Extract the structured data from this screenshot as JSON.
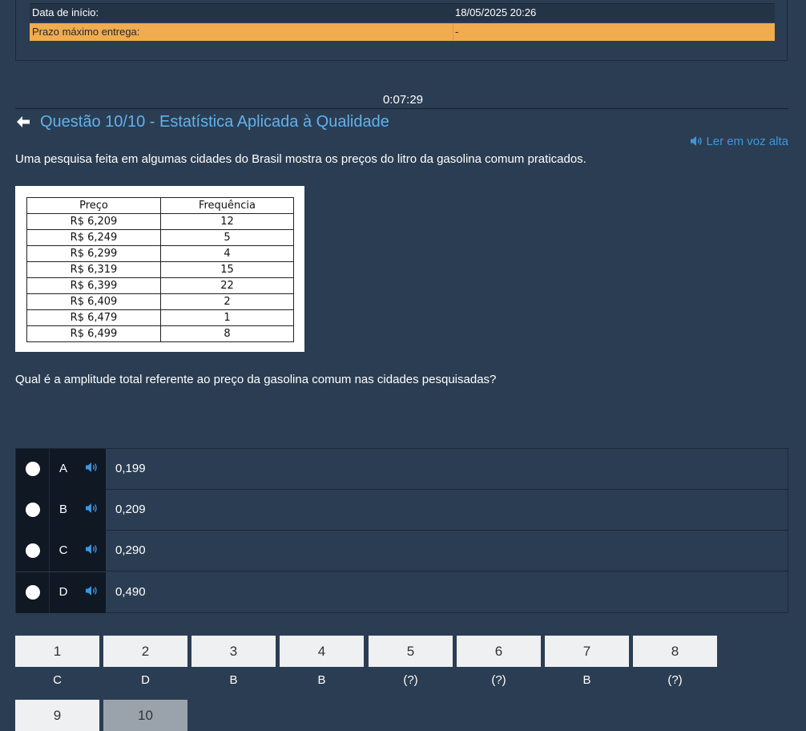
{
  "info": {
    "start_label": "Data de início:",
    "start_value": "18/05/2025 20:26",
    "deadline_label": "Prazo máximo entrega:",
    "deadline_value": "-"
  },
  "timer": "0:07:29",
  "question": {
    "title": "Questão 10/10 - Estatística Aplicada à Qualidade",
    "read_aloud_label": "Ler em voz alta",
    "statement": "Uma pesquisa feita em algumas cidades do Brasil mostra os preços do litro da gasolina comum praticados.",
    "prompt": "Qual é a amplitude total referente ao preço da gasolina comum nas cidades pesquisadas?"
  },
  "table": {
    "headers": [
      "Preço",
      "Frequência"
    ],
    "rows": [
      [
        "R$ 6,209",
        "12"
      ],
      [
        "R$ 6,249",
        "5"
      ],
      [
        "R$ 6,299",
        "4"
      ],
      [
        "R$ 6,319",
        "15"
      ],
      [
        "R$ 6,399",
        "22"
      ],
      [
        "R$ 6,409",
        "2"
      ],
      [
        "R$ 6,479",
        "1"
      ],
      [
        "R$ 6,499",
        "8"
      ]
    ]
  },
  "options": [
    {
      "letter": "A",
      "text": "0,199"
    },
    {
      "letter": "B",
      "text": "0,209"
    },
    {
      "letter": "C",
      "text": "0,290"
    },
    {
      "letter": "D",
      "text": "0,490"
    }
  ],
  "navigation": [
    {
      "number": "1",
      "answer": "C"
    },
    {
      "number": "2",
      "answer": "D"
    },
    {
      "number": "3",
      "answer": "B"
    },
    {
      "number": "4",
      "answer": "B"
    },
    {
      "number": "5",
      "answer": "(?)"
    },
    {
      "number": "6",
      "answer": "(?)"
    },
    {
      "number": "7",
      "answer": "B"
    },
    {
      "number": "8",
      "answer": "(?)"
    },
    {
      "number": "9",
      "answer": ""
    },
    {
      "number": "10",
      "answer": ""
    }
  ],
  "colors": {
    "background": "#2b3d52",
    "deadline_highlight": "#f0ac4e",
    "title_link": "#5fb2f0",
    "option_cell": "#0f1823"
  },
  "icons": {
    "back": "arrow-left-icon",
    "speaker": "speaker-icon",
    "radio": "radio-button"
  }
}
